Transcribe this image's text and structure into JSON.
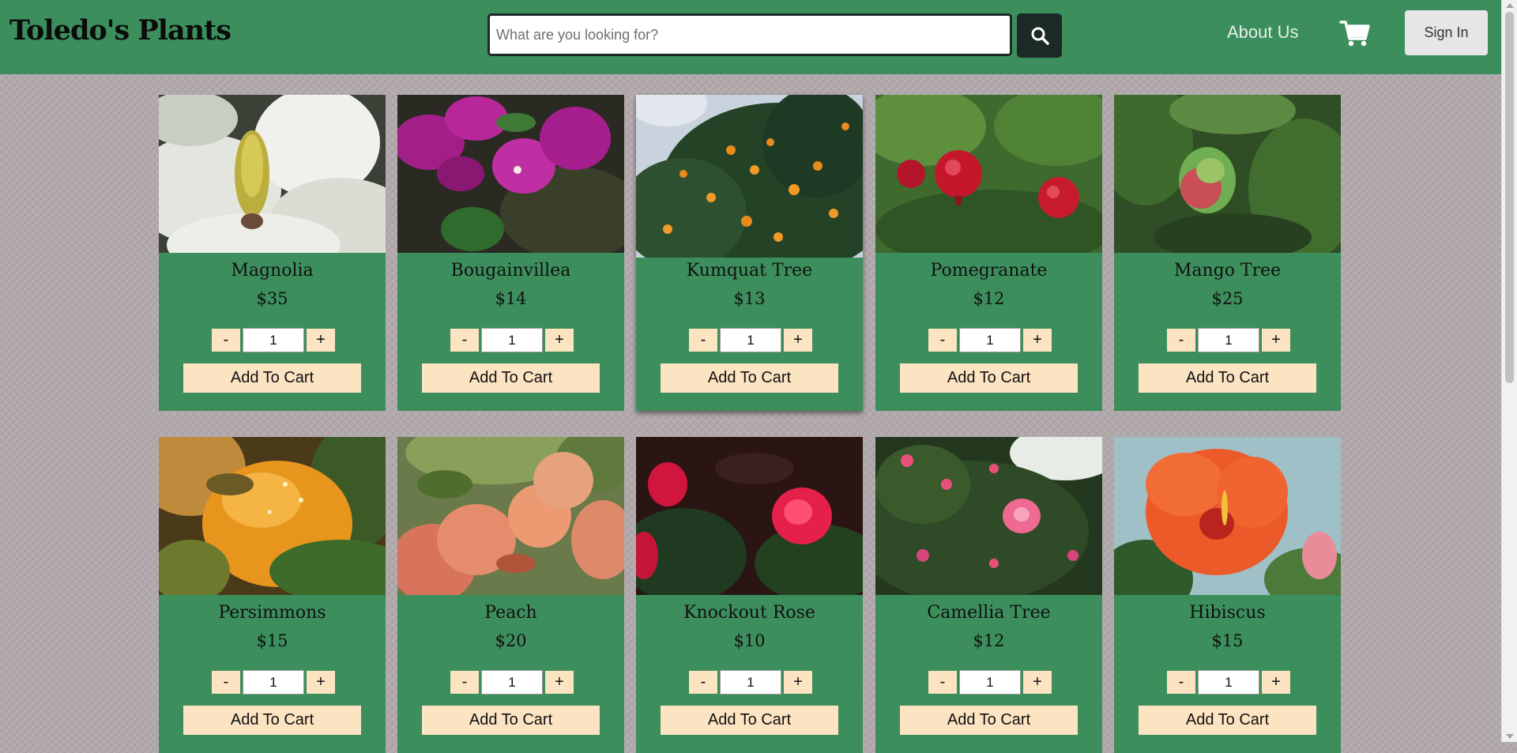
{
  "header": {
    "brand": "Toledo's Plants",
    "search_placeholder": "What are you looking for?",
    "search_value": "",
    "about_label": "About Us",
    "signin_label": "Sign In"
  },
  "colors": {
    "nav_green": "#3c8f5c",
    "card_green": "#3c8f5c",
    "button_peach": "#fce3c2",
    "search_dark": "#1b2a26"
  },
  "icons": {
    "search": "search-icon",
    "cart": "shopping-cart-icon"
  },
  "products": [
    {
      "name": "Magnolia",
      "price": "$35",
      "qty": "1",
      "minus": "-",
      "plus": "+",
      "add": "Add To Cart",
      "photo": "magnolia-photo"
    },
    {
      "name": "Bougainvillea",
      "price": "$14",
      "qty": "1",
      "minus": "-",
      "plus": "+",
      "add": "Add To Cart",
      "photo": "bougainvillea-photo"
    },
    {
      "name": "Kumquat Tree",
      "price": "$13",
      "qty": "1",
      "minus": "-",
      "plus": "+",
      "add": "Add To Cart",
      "photo": "kumquat-photo"
    },
    {
      "name": "Pomegranate",
      "price": "$12",
      "qty": "1",
      "minus": "-",
      "plus": "+",
      "add": "Add To Cart",
      "photo": "pomegranate-photo"
    },
    {
      "name": "Mango Tree",
      "price": "$25",
      "qty": "1",
      "minus": "-",
      "plus": "+",
      "add": "Add To Cart",
      "photo": "mango-photo"
    },
    {
      "name": "Persimmons",
      "price": "$15",
      "qty": "1",
      "minus": "-",
      "plus": "+",
      "add": "Add To Cart",
      "photo": "persimmon-photo"
    },
    {
      "name": "Peach",
      "price": "$20",
      "qty": "1",
      "minus": "-",
      "plus": "+",
      "add": "Add To Cart",
      "photo": "peach-photo"
    },
    {
      "name": "Knockout Rose",
      "price": "$10",
      "qty": "1",
      "minus": "-",
      "plus": "+",
      "add": "Add To Cart",
      "photo": "rose-photo"
    },
    {
      "name": "Camellia Tree",
      "price": "$12",
      "qty": "1",
      "minus": "-",
      "plus": "+",
      "add": "Add To Cart",
      "photo": "camellia-photo"
    },
    {
      "name": "Hibiscus",
      "price": "$15",
      "qty": "1",
      "minus": "-",
      "plus": "+",
      "add": "Add To Cart",
      "photo": "hibiscus-photo"
    }
  ]
}
